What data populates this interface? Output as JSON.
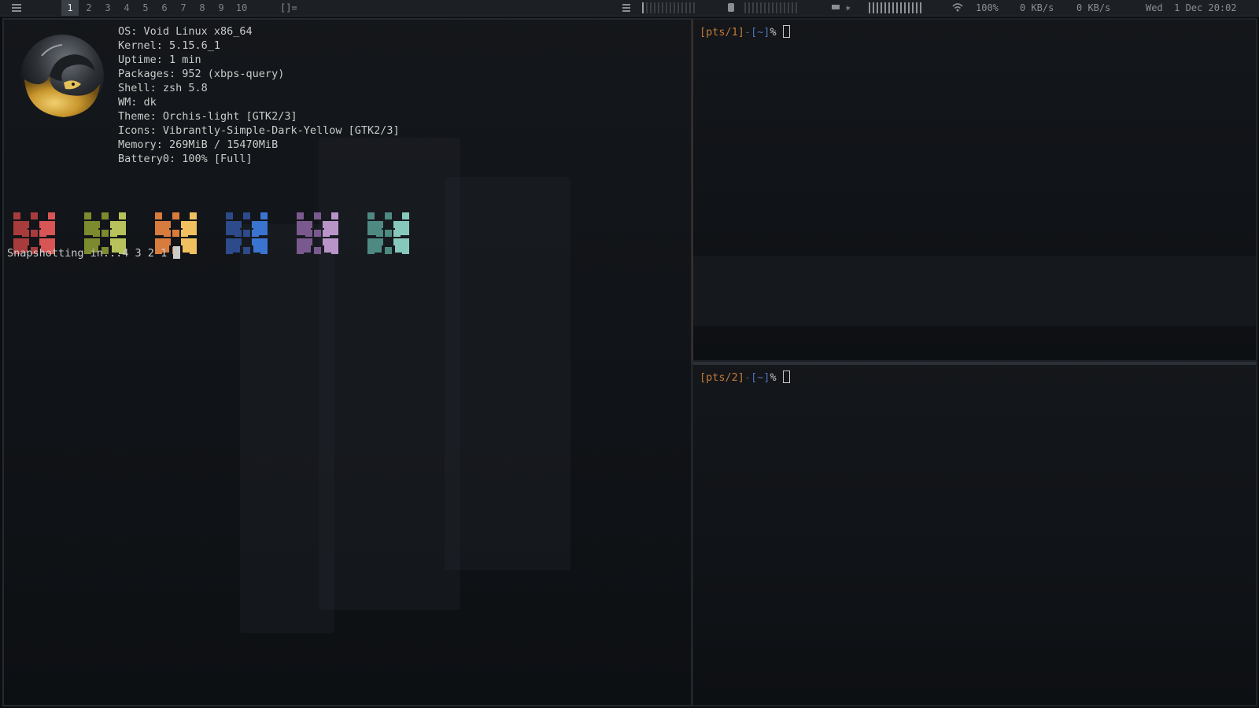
{
  "bar": {
    "menu_icon": "list-icon",
    "workspaces": [
      "1",
      "2",
      "3",
      "4",
      "5",
      "6",
      "7",
      "8",
      "9",
      "10"
    ],
    "active_workspace": "1",
    "layout_symbol": "[]=",
    "cpu_icon": "bars-icon",
    "mem_icon": "memory-chip-icon",
    "battery_icon": "battery-icon",
    "brightness_icon": "sun-icon",
    "wifi_icon": "wifi-icon",
    "wifi_strength": "100%",
    "net_down": "0 KB/s",
    "net_up": "0 KB/s",
    "datetime": "Wed  1 Dec 20:02"
  },
  "left_terminal": {
    "info": [
      "OS: Void Linux x86_64",
      "Kernel: 5.15.6_1",
      "Uptime: 1 min",
      "Packages: 952 (xbps-query)",
      "Shell: zsh 5.8",
      "WM: dk",
      "Theme: Orchis-light [GTK2/3]",
      "Icons: Vibrantly-Simple-Dark-Yellow [GTK2/3]",
      "Memory: 269MiB / 15470MiB",
      "Battery0: 100% [Full]"
    ],
    "logo": "void-dragon-logo",
    "palette": [
      {
        "name": "red",
        "dark": "#a83c3c",
        "light": "#d85555"
      },
      {
        "name": "green",
        "dark": "#7d8a2e",
        "light": "#b8c25a"
      },
      {
        "name": "orange",
        "dark": "#d87c3e",
        "light": "#f0c060"
      },
      {
        "name": "blue",
        "dark": "#2d4a8a",
        "light": "#3b74d0"
      },
      {
        "name": "purple",
        "dark": "#7a5a8e",
        "light": "#b894c8"
      },
      {
        "name": "cyan",
        "dark": "#4e8a82",
        "light": "#88c8bc"
      }
    ],
    "status_line": "Snapshotting in...4 3 2 1"
  },
  "top_right_terminal": {
    "pts": "[pts/1]",
    "sep": "-",
    "dir": "[~]",
    "prompt_char": "%"
  },
  "bottom_right_terminal": {
    "pts": "[pts/2]",
    "sep": "-",
    "dir": "[~]",
    "prompt_char": "%"
  }
}
